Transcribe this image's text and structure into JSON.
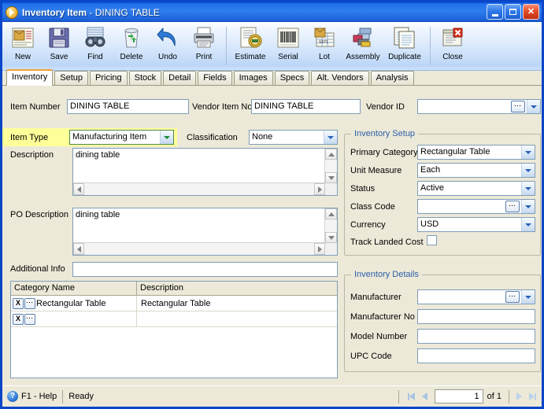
{
  "window": {
    "title_main": "Inventory Item",
    "title_sub": " - DINING TABLE",
    "app_icon": "inventory-app-icon",
    "minimize_label": "Minimize",
    "maximize_label": "Maximize",
    "close_label": "Close",
    "accent_orange": "#f0a030",
    "titlebar_blue": "#2f7ef0",
    "group_title_color": "#2d5fa8",
    "highlight_yellow": "#ffff99"
  },
  "toolbar": {
    "buttons": [
      {
        "label": "New",
        "icon": "new-item-icon"
      },
      {
        "label": "Save",
        "icon": "floppy-disk-icon"
      },
      {
        "label": "Find",
        "icon": "binoculars-icon"
      },
      {
        "label": "Delete",
        "icon": "recycle-bin-icon"
      },
      {
        "label": "Undo",
        "icon": "undo-arrow-icon"
      },
      {
        "label": "Print",
        "icon": "printer-icon"
      },
      {
        "label": "Estimate",
        "icon": "estimate-money-icon"
      },
      {
        "label": "Serial",
        "icon": "barcode-icon"
      },
      {
        "label": "Lot",
        "icon": "lot-box-icon"
      },
      {
        "label": "Assembly",
        "icon": "assembly-blocks-icon"
      },
      {
        "label": "Duplicate",
        "icon": "duplicate-pages-icon"
      },
      {
        "label": "Close",
        "icon": "close-window-icon"
      }
    ]
  },
  "tabs": [
    {
      "label": "Inventory",
      "active": true
    },
    {
      "label": "Setup",
      "active": false
    },
    {
      "label": "Pricing",
      "active": false
    },
    {
      "label": "Stock",
      "active": false
    },
    {
      "label": "Detail",
      "active": false
    },
    {
      "label": "Fields",
      "active": false
    },
    {
      "label": "Images",
      "active": false
    },
    {
      "label": "Specs",
      "active": false
    },
    {
      "label": "Alt. Vendors",
      "active": false
    },
    {
      "label": "Analysis",
      "active": false
    }
  ],
  "form": {
    "item_number_label": "Item Number",
    "item_number_value": "DINING TABLE",
    "vendor_item_no_label": "Vendor Item No",
    "vendor_item_no_value": "DINING TABLE",
    "vendor_id_label": "Vendor ID",
    "vendor_id_value": "",
    "item_type_label": "Item Type",
    "item_type_value": "Manufacturing Item",
    "classification_label": "Classification",
    "classification_value": "None",
    "description_label": "Description",
    "description_value": "dining table",
    "po_description_label": "PO Description",
    "po_description_value": "dining table",
    "additional_info_label": "Additional Info",
    "additional_info_value": ""
  },
  "grid": {
    "columns": [
      "Category Name",
      "Description"
    ],
    "rows": [
      {
        "category": "Rectangular Table",
        "description": "Rectangular Table"
      },
      {
        "category": "",
        "description": ""
      }
    ],
    "delete_glyph": "X",
    "lookup_glyph": "..."
  },
  "inventory_setup": {
    "title": "Inventory Setup",
    "fields": [
      {
        "label": "Primary Category",
        "value": "Rectangular Table",
        "kind": "combo"
      },
      {
        "label": "Unit Measure",
        "value": "Each",
        "kind": "combo"
      },
      {
        "label": "Status",
        "value": "Active",
        "kind": "combo"
      },
      {
        "label": "Class Code",
        "value": "",
        "kind": "combo-lookup"
      },
      {
        "label": "Currency",
        "value": "USD",
        "kind": "combo"
      }
    ],
    "track_landed_cost_label": "Track Landed Cost",
    "track_landed_cost_checked": false
  },
  "inventory_details": {
    "title": "Inventory Details",
    "fields": [
      {
        "label": "Manufacturer",
        "value": "",
        "kind": "combo-lookup"
      },
      {
        "label": "Manufacturer No",
        "value": "",
        "kind": "text"
      },
      {
        "label": "Model Number",
        "value": "",
        "kind": "text"
      },
      {
        "label": "UPC Code",
        "value": "",
        "kind": "text"
      }
    ]
  },
  "statusbar": {
    "help_icon": "help-question-icon",
    "help_label": "F1 - Help",
    "status_text": "Ready",
    "page_value": "1",
    "of_label": "of  1",
    "first_label": "First record",
    "prev_label": "Previous record",
    "next_label": "Next record",
    "last_label": "Last record"
  }
}
